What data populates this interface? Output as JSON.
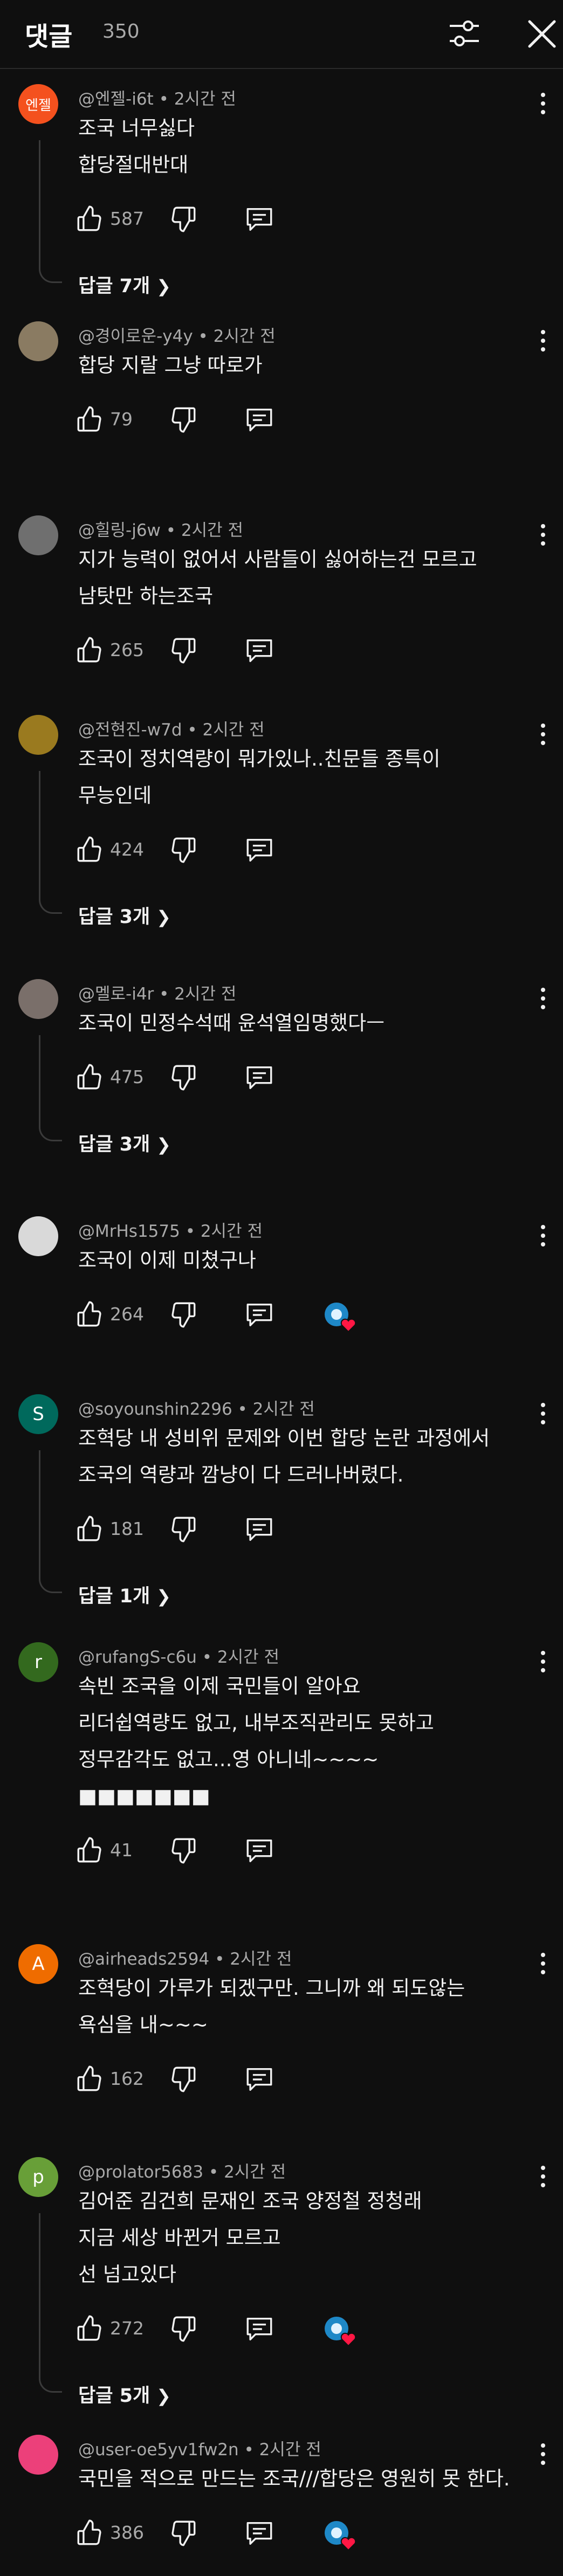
{
  "header": {
    "title": "댓글",
    "count": "350"
  },
  "comments": [
    {
      "avatar_text": "엔젤",
      "avatar_color": "#f4511e",
      "author": "@엔젤-i6t • 2시간 전",
      "lines": [
        "조국 너무싫다",
        "합당절대반대"
      ],
      "likes": "587",
      "replies": "답글 7개"
    },
    {
      "avatar_text": "",
      "avatar_color": "#8a7b62",
      "author": "@경이로운-y4y • 2시간 전",
      "lines": [
        "합당 지랄 그냥 따로가"
      ],
      "likes": "79"
    },
    {
      "avatar_text": "",
      "avatar_color": "#6f6f6f",
      "author": "@힐링-j6w • 2시간 전",
      "lines": [
        "지가 능력이 없어서 사람들이 싫어하는건 모르고",
        "남탓만 하는조국"
      ],
      "likes": "265"
    },
    {
      "avatar_text": "",
      "avatar_color": "#9a7a1f",
      "author": "@전현진-w7d • 2시간 전",
      "lines": [
        "조국이 정치역량이 뭐가있나..친문들 종특이",
        "무능인데"
      ],
      "likes": "424",
      "replies": "답글 3개"
    },
    {
      "avatar_text": "",
      "avatar_color": "#7a6f6a",
      "author": "@멜로-i4r • 2시간 전",
      "lines": [
        "조국이 민정수석때 윤석열임명했다ㅡ"
      ],
      "likes": "475",
      "replies": "답글 3개"
    },
    {
      "avatar_text": "",
      "avatar_color": "#d9d9d9",
      "author": "@MrHs1575 • 2시간 전",
      "lines": [
        "조국이 이제 미쳤구나"
      ],
      "likes": "264",
      "creator_heart": true
    },
    {
      "avatar_text": "S",
      "avatar_color": "#00695c",
      "author": "@soyounshin2296 • 2시간 전",
      "lines": [
        "조혁당 내 성비위 문제와 이번 합당 논란 과정에서",
        "조국의 역량과 깜냥이 다 드러나버렸다."
      ],
      "likes": "181",
      "replies": "답글 1개"
    },
    {
      "avatar_text": "r",
      "avatar_color": "#33691e",
      "author": "@rufangS-c6u • 2시간 전",
      "lines": [
        "속빈 조국을 이제 국민들이 알아요",
        "리더쉽역량도 없고, 내부조직관리도 못하고",
        "정무감각도 없고...영 아니네~~~~",
        "■■■■■■■"
      ],
      "likes": "41"
    },
    {
      "avatar_text": "A",
      "avatar_color": "#ef6c00",
      "author": "@airheads2594 • 2시간 전",
      "lines": [
        "조혁당이 가루가 되겠구만. 그니까 왜 되도않는",
        "욕심을 내~~~"
      ],
      "likes": "162"
    },
    {
      "avatar_text": "p",
      "avatar_color": "#689f38",
      "author": "@prolator5683 • 2시간 전",
      "lines": [
        "김어준 김건희 문재인 조국 양정철 정청래",
        "지금 세상 바뀐거 모르고",
        "선 넘고있다"
      ],
      "likes": "272",
      "creator_heart": true,
      "replies": "답글 5개"
    },
    {
      "avatar_text": "",
      "avatar_color": "#ec407a",
      "author": "@user-oe5yv1fw2n • 2시간 전",
      "lines": [
        "국민을 적으로 만드는 조국///합당은 영원히 못 한다."
      ],
      "likes": "386",
      "creator_heart": true
    }
  ],
  "icons": {
    "filter": "tune-icon",
    "close": "close-icon",
    "like": "thumb-up-icon",
    "dislike": "thumb-down-icon",
    "reply": "comment-icon",
    "more": "more-vert-icon",
    "heart": "creator-heart-icon",
    "chevron": "chevron-right-icon"
  }
}
